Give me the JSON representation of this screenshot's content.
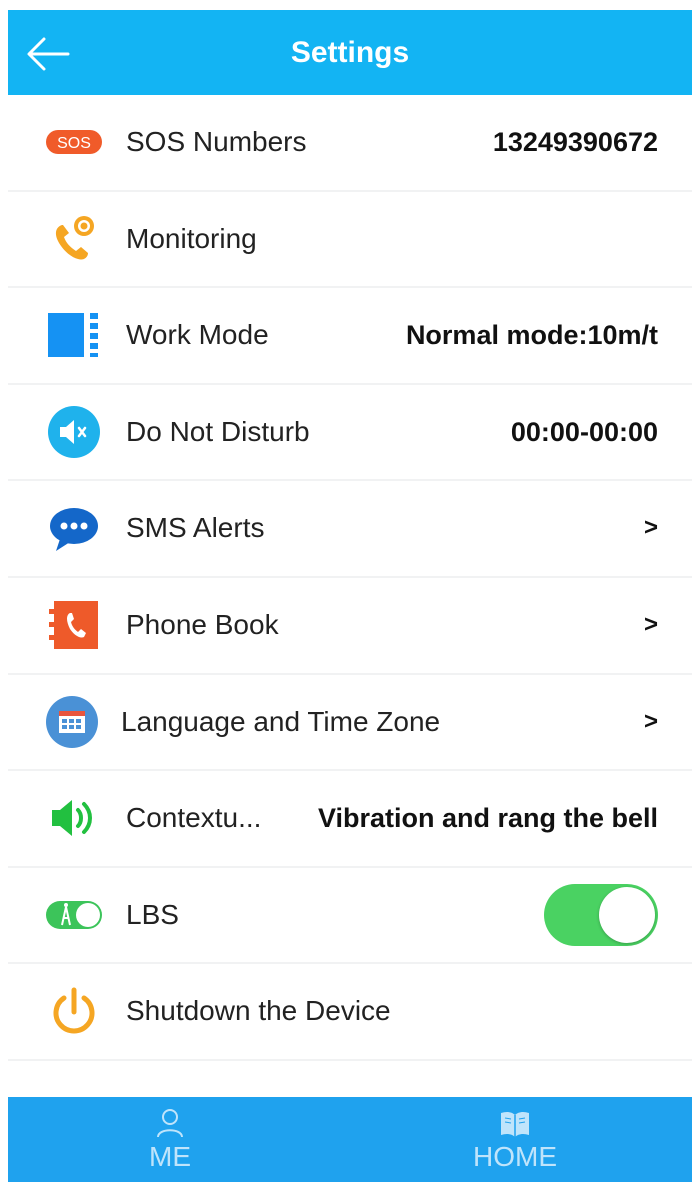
{
  "header": {
    "title": "Settings"
  },
  "settings": {
    "sos": {
      "label": "SOS Numbers",
      "value": "13249390672",
      "badge": "SOS"
    },
    "monitoring": {
      "label": "Monitoring"
    },
    "work_mode": {
      "label": "Work Mode",
      "value": "Normal mode:10m/t"
    },
    "dnd": {
      "label": "Do Not Disturb",
      "value": "00:00-00:00"
    },
    "sms": {
      "label": "SMS Alerts",
      "chevron": ">"
    },
    "phonebook": {
      "label": "Phone Book",
      "chevron": ">"
    },
    "language": {
      "label": "Language and Time Zone",
      "chevron": ">"
    },
    "contextual": {
      "label": "Contextu...",
      "value": "Vibration and rang the bell"
    },
    "lbs": {
      "label": "LBS",
      "enabled": true
    },
    "shutdown": {
      "label": "Shutdown the Device"
    }
  },
  "tabbar": {
    "me_label": "ME",
    "home_label": "HOME"
  },
  "colors": {
    "header": "#13b4f3",
    "tabbar": "#1fa2ee",
    "toggle_on": "#4ad262"
  }
}
